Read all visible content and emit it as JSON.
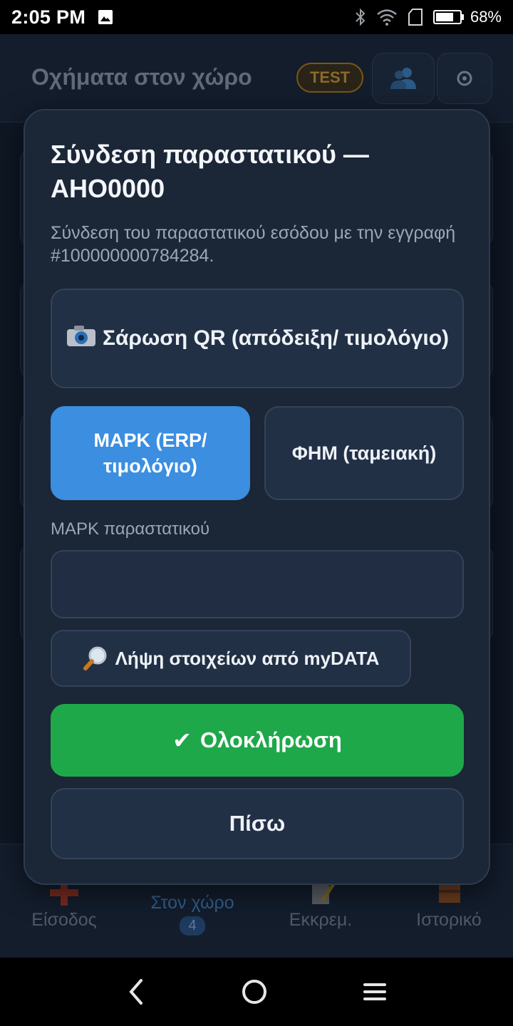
{
  "status_bar": {
    "time": "2:05 PM",
    "battery": "68%"
  },
  "header": {
    "title": "Οχήματα στον χώρο",
    "badge": "TEST"
  },
  "bottom_nav": {
    "items": [
      {
        "label": "Είσοδος"
      },
      {
        "label": "Στον χώρο",
        "count": "4"
      },
      {
        "label": "Εκκρεμ."
      },
      {
        "label": "Ιστορικό"
      }
    ]
  },
  "modal": {
    "title": "Σύνδεση παραστατικού — AHO0000",
    "description": "Σύνδεση του παραστατικού εσόδου με την εγγραφή #100000000784284.",
    "scan_button": "Σάρωση QR (απόδειξη/ τιμολόγιο)",
    "tabs": [
      {
        "label": "ΜΑΡΚ (ERP/ τιμολόγιο)",
        "active": true
      },
      {
        "label": "ΦΗΜ (ταμειακή)",
        "active": false
      }
    ],
    "field_label": "ΜΑΡΚ παραστατικού",
    "field_value": "",
    "mydata_button": "Λήψη στοιχείων από myDATA",
    "complete_button": "Ολοκλήρωση",
    "back_button": "Πίσω"
  },
  "colors": {
    "accent_blue": "#3b8ee0",
    "success_green": "#1ea84a",
    "modal_bg": "#1b2636"
  }
}
